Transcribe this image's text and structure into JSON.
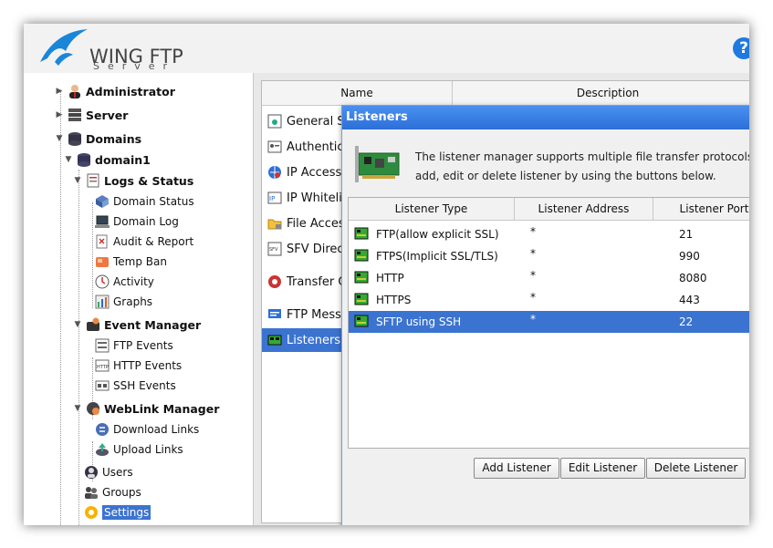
{
  "app": {
    "logo_text": "WING FTP",
    "logo_sub": "Server",
    "help_label": "?"
  },
  "tree": {
    "items": [
      {
        "label": "Administrator",
        "icon": "admin-icon"
      },
      {
        "label": "Server",
        "icon": "server-icon"
      },
      {
        "label": "Domains",
        "icon": "domains-icon"
      },
      {
        "label": "domain1",
        "icon": "domain-icon"
      },
      {
        "label": "Logs & Status",
        "icon": "logs-icon"
      },
      {
        "label": "Domain Status",
        "icon": "domain-status-icon"
      },
      {
        "label": "Domain Log",
        "icon": "domain-log-icon"
      },
      {
        "label": "Audit & Report",
        "icon": "audit-icon"
      },
      {
        "label": "Temp Ban",
        "icon": "temp-ban-icon"
      },
      {
        "label": "Activity",
        "icon": "activity-icon"
      },
      {
        "label": "Graphs",
        "icon": "graphs-icon"
      },
      {
        "label": "Event Manager",
        "icon": "event-manager-icon"
      },
      {
        "label": "FTP Events",
        "icon": "ftp-events-icon"
      },
      {
        "label": "HTTP Events",
        "icon": "http-events-icon"
      },
      {
        "label": "SSH Events",
        "icon": "ssh-events-icon"
      },
      {
        "label": "WebLink Manager",
        "icon": "weblink-icon"
      },
      {
        "label": "Download Links",
        "icon": "download-links-icon"
      },
      {
        "label": "Upload Links",
        "icon": "upload-links-icon"
      },
      {
        "label": "Users",
        "icon": "users-icon"
      },
      {
        "label": "Groups",
        "icon": "groups-icon"
      },
      {
        "label": "Settings",
        "icon": "settings-icon"
      }
    ]
  },
  "settings_table": {
    "headers": [
      "Name",
      "Description"
    ],
    "rows": [
      {
        "label": "General S",
        "icon": "general-settings-icon"
      },
      {
        "label": "Authentica",
        "icon": "authentication-icon"
      },
      {
        "label": "IP Access",
        "icon": "ip-access-icon"
      },
      {
        "label": "IP Whitelis",
        "icon": "ip-whitelist-icon"
      },
      {
        "label": "File Acces",
        "icon": "file-access-icon"
      },
      {
        "label": "SFV Direct",
        "icon": "sfv-icon"
      },
      {
        "label": "Transfer C",
        "icon": "transfer-icon"
      },
      {
        "label": "FTP Messa",
        "icon": "ftp-message-icon"
      },
      {
        "label": "Listeners",
        "icon": "listeners-icon"
      }
    ]
  },
  "dialog": {
    "title": "Listeners",
    "desc_line1": "The listener manager supports multiple file transfer protocols or",
    "desc_line2": "add, edit or delete listener by using the buttons below.",
    "columns": [
      "Listener Type",
      "Listener Address",
      "Listener Port"
    ],
    "listeners": [
      {
        "type": "FTP(allow explicit SSL)",
        "address": "*",
        "port": "21"
      },
      {
        "type": "FTPS(Implicit SSL/TLS)",
        "address": "*",
        "port": "990"
      },
      {
        "type": "HTTP",
        "address": "*",
        "port": "8080"
      },
      {
        "type": "HTTPS",
        "address": "*",
        "port": "443"
      },
      {
        "type": "SFTP using SSH",
        "address": "*",
        "port": "22"
      }
    ],
    "selected_index": 4,
    "buttons": {
      "add": "Add Listener",
      "edit": "Edit Listener",
      "delete": "Delete Listener"
    }
  },
  "colors": {
    "accent": "#3b73d0",
    "title_bar": "#2c6fd8",
    "help": "#1e7ae0"
  }
}
